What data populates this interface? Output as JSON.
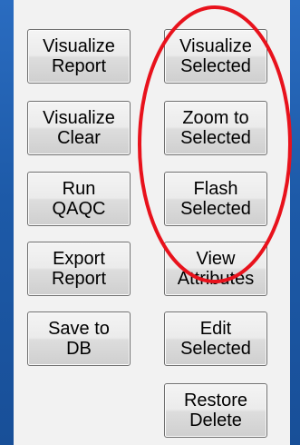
{
  "buttons": {
    "left": [
      {
        "id": "visualize-report",
        "label": "Visualize\nReport"
      },
      {
        "id": "visualize-clear",
        "label": "Visualize\nClear"
      },
      {
        "id": "run-qaqc",
        "label": "Run\nQAQC"
      },
      {
        "id": "export-report",
        "label": "Export\nReport"
      },
      {
        "id": "save-to-db",
        "label": "Save to\nDB"
      }
    ],
    "right": [
      {
        "id": "visualize-selected",
        "label": "Visualize\nSelected"
      },
      {
        "id": "zoom-to-selected",
        "label": "Zoom to\nSelected"
      },
      {
        "id": "flash-selected",
        "label": "Flash\nSelected"
      },
      {
        "id": "view-attributes",
        "label": "View\nAttributes"
      },
      {
        "id": "edit-selected",
        "label": "Edit\nSelected"
      },
      {
        "id": "restore-delete",
        "label": "Restore\nDelete"
      }
    ]
  },
  "annotation": {
    "shape": "ellipse",
    "color": "#e8121c",
    "encloses": [
      "visualize-selected",
      "zoom-to-selected",
      "flash-selected"
    ]
  }
}
